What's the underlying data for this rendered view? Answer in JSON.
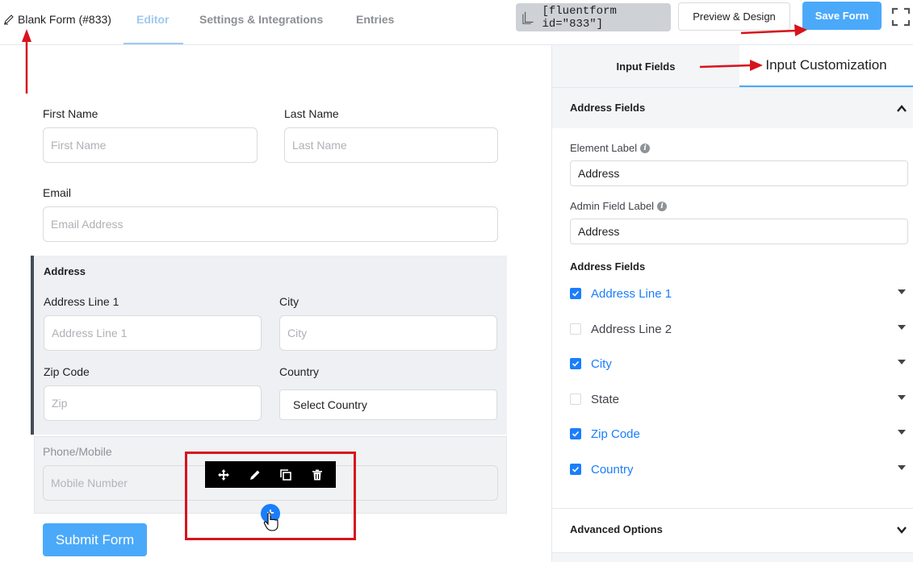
{
  "header": {
    "form_title": "Blank Form (#833)",
    "tabs": [
      {
        "label": "Editor",
        "active": true
      },
      {
        "label": "Settings & Integrations",
        "active": false
      },
      {
        "label": "Entries",
        "active": false
      }
    ],
    "shortcode": "[fluentform id=\"833\"]",
    "preview_label": "Preview & Design",
    "save_label": "Save Form",
    "icons": [
      "pencil-icon",
      "copy-icon",
      "fullscreen-icon"
    ]
  },
  "form": {
    "first_name": {
      "label": "First Name",
      "placeholder": "First Name"
    },
    "last_name": {
      "label": "Last Name",
      "placeholder": "Last Name"
    },
    "email": {
      "label": "Email",
      "placeholder": "Email Address"
    },
    "address": {
      "title": "Address",
      "line1": {
        "label": "Address Line 1",
        "placeholder": "Address Line 1"
      },
      "city": {
        "label": "City",
        "placeholder": "City"
      },
      "zip": {
        "label": "Zip Code",
        "placeholder": "Zip"
      },
      "country": {
        "label": "Country",
        "value": "Select Country"
      }
    },
    "phone": {
      "label": "Phone/Mobile",
      "placeholder": "Mobile Number"
    },
    "toolbar_icons": [
      "move-icon",
      "edit-icon",
      "duplicate-icon",
      "trash-icon"
    ],
    "add_symbol": "+",
    "submit_label": "Submit Form"
  },
  "panel": {
    "tabs": {
      "input_fields": "Input Fields",
      "input_customization": "Input Customization"
    },
    "section_title": "Address Fields",
    "element_label": {
      "label": "Element Label",
      "value": "Address"
    },
    "admin_label": {
      "label": "Admin Field Label",
      "value": "Address"
    },
    "subtitle": "Address Fields",
    "fields": [
      {
        "label": "Address Line 1",
        "checked": true
      },
      {
        "label": "Address Line 2",
        "checked": false
      },
      {
        "label": "City",
        "checked": true
      },
      {
        "label": "State",
        "checked": false
      },
      {
        "label": "Zip Code",
        "checked": true
      },
      {
        "label": "Country",
        "checked": true
      }
    ],
    "advanced_title": "Advanced Options"
  },
  "colors": {
    "accent": "#4ba9fa",
    "primary": "#1a7efb",
    "annotation_red": "#d8131d",
    "dark": "#454c57"
  }
}
